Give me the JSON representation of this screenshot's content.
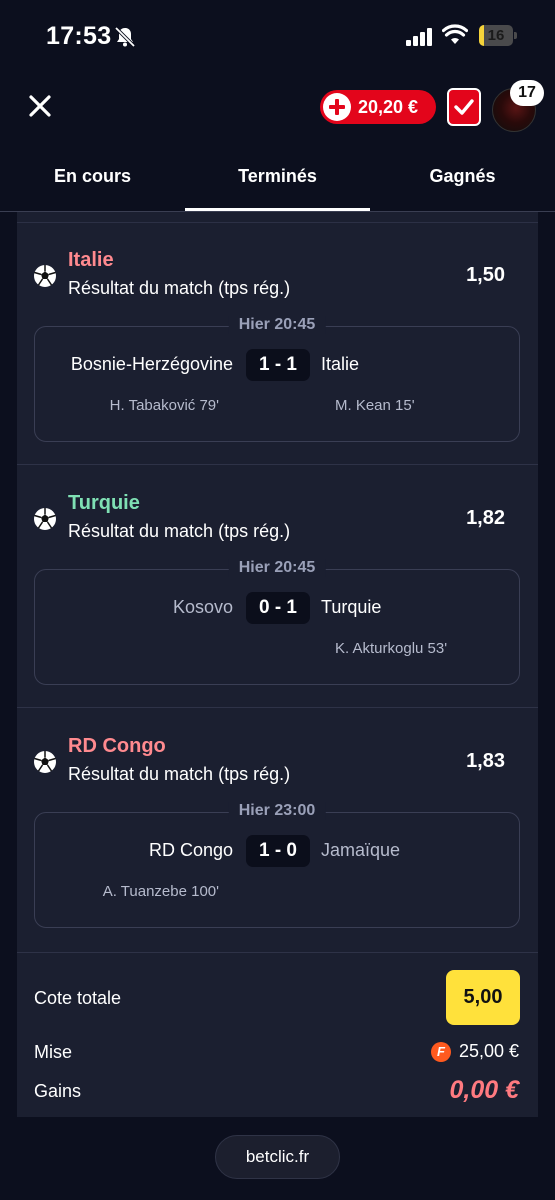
{
  "status_bar": {
    "time": "17:53",
    "battery": "16",
    "battery_level": 0.16,
    "icons": [
      "bell-slash-icon",
      "signal-icon",
      "wifi-icon",
      "battery-icon"
    ]
  },
  "header": {
    "close_icon": "close-icon",
    "balance": "20,20 €",
    "notification_count": "17",
    "accent_color": "#e3051b"
  },
  "tabs": [
    {
      "label": "En cours"
    },
    {
      "label": "Terminés"
    },
    {
      "label": "Gagnés"
    }
  ],
  "active_tab": "Terminés",
  "bets": [
    {
      "selection": "Italie",
      "selection_color": "#ff8a8f",
      "market": "Résultat du match (tps rég.)",
      "odd": "1,50",
      "date": "Hier 20:45",
      "home": "Bosnie-Herzégovine",
      "away": "Italie",
      "score": "1 - 1",
      "home_scorer": "H. Tabaković 79'",
      "away_scorer": "M. Kean 15'"
    },
    {
      "selection": "Turquie",
      "selection_color": "#7fe0b4",
      "market": "Résultat du match (tps rég.)",
      "odd": "1,82",
      "date": "Hier 20:45",
      "home": "Kosovo",
      "away": "Turquie",
      "score": "0 - 1",
      "home_scorer": "",
      "away_scorer": "K. Akturkoglu 53'"
    },
    {
      "selection": "RD Congo",
      "selection_color": "#ff8a8f",
      "market": "Résultat du match (tps rég.)",
      "odd": "1,83",
      "date": "Hier 23:00",
      "home": "RD Congo",
      "away": "Jamaïque",
      "score": "1 - 0",
      "home_scorer": "A. Tuanzebe 100'",
      "away_scorer": ""
    }
  ],
  "summary": {
    "cote_label": "Cote totale",
    "cote_value": "5,00",
    "mise_label": "Mise",
    "coin_letter": "F",
    "mise_value": "25,00 €",
    "gains_label": "Gains",
    "gains_value": "0,00 €"
  },
  "footer": {
    "url": "betclic.fr"
  }
}
